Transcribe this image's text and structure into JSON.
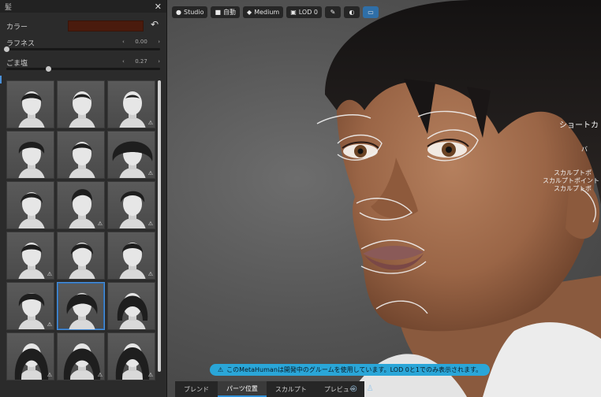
{
  "panel": {
    "title": "髪",
    "close_icon": "close-icon",
    "color_label": "カラー",
    "color_value": "#4a1b0d",
    "reset_icon": "undo-icon",
    "roughness": {
      "label": "ラフネス",
      "value_text": "0.00",
      "fraction": 0.0
    },
    "salt_pepper": {
      "label": "ごま塩",
      "value_text": "0.27",
      "fraction": 0.27
    },
    "warning_icon": "warning-icon",
    "tiles": [
      {
        "style": "short-crop",
        "warning": false
      },
      {
        "style": "receding",
        "warning": false
      },
      {
        "style": "bald",
        "warning": true
      },
      {
        "style": "curly-short",
        "warning": false
      },
      {
        "style": "buzz",
        "warning": false
      },
      {
        "style": "afro",
        "warning": true
      },
      {
        "style": "short-side",
        "warning": false
      },
      {
        "style": "pompadour",
        "warning": true
      },
      {
        "style": "spiky",
        "warning": true
      },
      {
        "style": "short-flat",
        "warning": true
      },
      {
        "style": "side-part",
        "warning": false
      },
      {
        "style": "slicked",
        "warning": true
      },
      {
        "style": "wavy-short",
        "warning": true
      },
      {
        "style": "shaggy",
        "warning": false,
        "selected": true
      },
      {
        "style": "bob",
        "warning": false
      },
      {
        "style": "long-straight",
        "warning": true
      },
      {
        "style": "long-wavy",
        "warning": true
      },
      {
        "style": "long-dark",
        "warning": true
      }
    ]
  },
  "toolbar": {
    "studio": {
      "icon": "bulb-icon",
      "label": "Studio"
    },
    "auto": {
      "icon": "camera-icon",
      "label": "自動"
    },
    "medium": {
      "icon": "diamond-icon",
      "label": "Medium"
    },
    "lod": {
      "icon": "lod-icon",
      "label": "LOD 0"
    },
    "tool1_icon": "sculpt-icon",
    "tool2_icon": "blend-icon",
    "tool3_icon": "screen-icon"
  },
  "viewport": {
    "title_right": "ショートカ",
    "side_labels": [
      "バ",
      "スカルプトポ",
      "スカルプトポイント",
      "スカルプトポ"
    ],
    "notice_icon": "warning-icon",
    "notice": "このMetaHumanは開発中のグルームを使用しています。LOD 0と1でのみ表示されます。"
  },
  "bottom_tabs": [
    "ブレンド",
    "パーツ位置",
    "スカルプト",
    "プレビュー"
  ],
  "bottom_active": 1,
  "bottom_icons": [
    "globe-icon",
    "person-icon"
  ],
  "colors": {
    "accent": "#2f8fd8",
    "notice_bg": "#2aa6d8",
    "panel_bg": "#2b2b2b"
  }
}
